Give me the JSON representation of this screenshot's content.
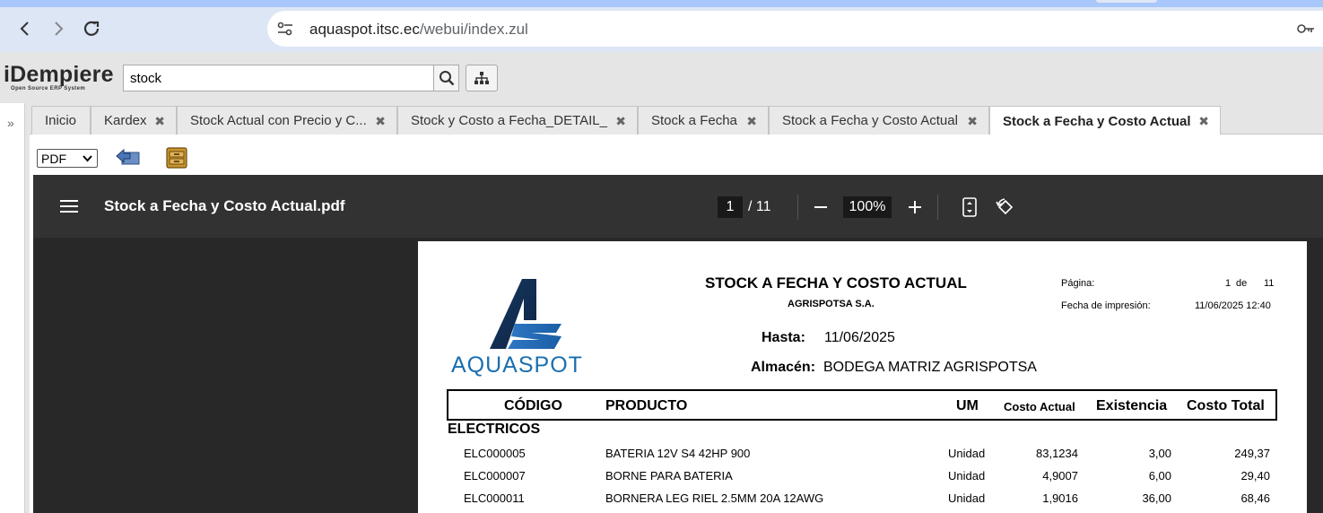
{
  "browser": {
    "url_host": "aquaspot.itsc.ec",
    "url_path": "/webui/index.zul"
  },
  "app": {
    "logo": "iDempiere",
    "logo_sub": "Open Source ERP System",
    "search_value": "stock"
  },
  "tabs": [
    {
      "label": "Inicio",
      "closable": false
    },
    {
      "label": "Kardex",
      "closable": true
    },
    {
      "label": "Stock Actual con Precio y C...",
      "closable": true
    },
    {
      "label": "Stock y Costo a Fecha_DETAIL_",
      "closable": true
    },
    {
      "label": "Stock a Fecha",
      "closable": true
    },
    {
      "label": "Stock a Fecha y Costo Actual",
      "closable": true
    },
    {
      "label": "Stock a Fecha y Costo Actual",
      "closable": true,
      "active": true
    }
  ],
  "report_toolbar": {
    "format": "PDF"
  },
  "viewer": {
    "filename": "Stock a Fecha y Costo Actual.pdf",
    "page_current": "1",
    "page_total": "/ 11",
    "zoom": "100%"
  },
  "report": {
    "title": "STOCK A FECHA Y COSTO ACTUAL",
    "company": "AGRISPOTSA S.A.",
    "page_label": "Página:",
    "page_num": "1",
    "page_of": "de",
    "page_total": "11",
    "print_label": "Fecha de impresión:",
    "print_date": "11/06/2025 12:40",
    "hasta_label": "Hasta:",
    "hasta_value": "11/06/2025",
    "almacen_label": "Almacén:",
    "almacen_value": "BODEGA MATRIZ AGRISPOTSA",
    "logo_text": "AQUASPOT",
    "headers": {
      "codigo": "CÓDIGO",
      "producto": "PRODUCTO",
      "um": "UM",
      "costo_actual": "Costo Actual",
      "existencia": "Existencia",
      "costo_total": "Costo Total"
    },
    "group": "ELECTRICOS",
    "rows": [
      {
        "codigo": "ELC000005",
        "producto": "BATERIA 12V S4 42HP 900",
        "um": "Unidad",
        "costo": "83,1234",
        "existencia": "3,00",
        "total": "249,37"
      },
      {
        "codigo": "ELC000007",
        "producto": "BORNE PARA BATERIA",
        "um": "Unidad",
        "costo": "4,9007",
        "existencia": "6,00",
        "total": "29,40"
      },
      {
        "codigo": "ELC000011",
        "producto": "BORNERA LEG RIEL 2.5MM 20A 12AWG",
        "um": "Unidad",
        "costo": "1,9016",
        "existencia": "36,00",
        "total": "68,46"
      }
    ]
  },
  "colors": {
    "chrome_toolbar": "#dde6f5",
    "app_header": "#e5e5e5",
    "viewer_bar": "#323232",
    "viewer_bg": "#282828",
    "logo_blue": "#1a6fb0"
  }
}
